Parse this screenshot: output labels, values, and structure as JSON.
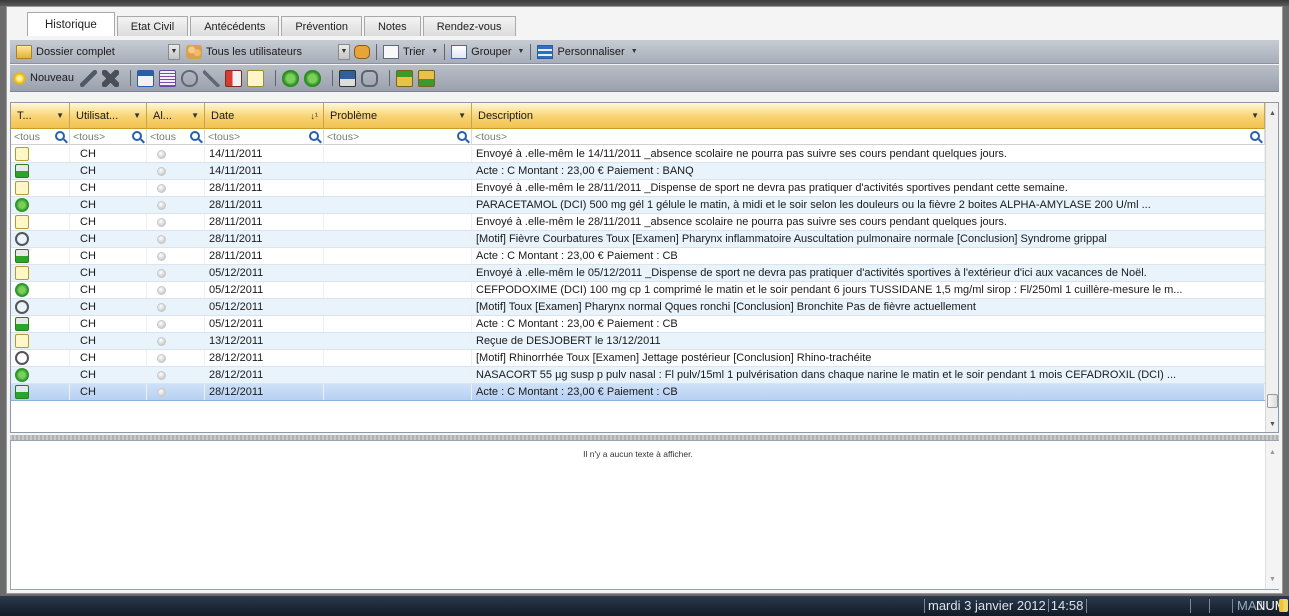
{
  "tabs": [
    {
      "label": "Historique"
    },
    {
      "label": "Etat Civil"
    },
    {
      "label": "Antécédents"
    },
    {
      "label": "Prévention"
    },
    {
      "label": "Notes"
    },
    {
      "label": "Rendez-vous"
    }
  ],
  "toolbar1": {
    "dossier": "Dossier complet",
    "users": "Tous les utilisateurs",
    "trier": "Trier",
    "grouper": "Grouper",
    "personnaliser": "Personnaliser"
  },
  "toolbar2": {
    "nouveau": "Nouveau"
  },
  "grid": {
    "headers": {
      "type": "T...",
      "user": "Utilisat...",
      "al": "Al...",
      "date": "Date",
      "date_sort": "↓¹",
      "prob": "Problème",
      "desc": "Description"
    },
    "filters": {
      "type": "<tous",
      "user": "<tous>",
      "al": "<tous",
      "date": "<tous>",
      "prob": "<tous>",
      "desc": "<tous>"
    },
    "rows": [
      {
        "icon": "absence",
        "user": "CH",
        "date": "14/11/2011",
        "problem": "",
        "description": "Envoyé à  .elle-mêm le 14/11/2011 _absence scolaire    ne pourra pas suivre ses cours pendant quelques jours."
      },
      {
        "icon": "acte",
        "user": "CH",
        "date": "14/11/2011",
        "problem": "",
        "description": "Acte : C  Montant : 23,00 €  Paiement : BANQ"
      },
      {
        "icon": "sport",
        "user": "CH",
        "date": "28/11/2011",
        "problem": "",
        "description": "Envoyé à  .elle-mêm le 28/11/2011 _Dispense de sport      ne devra pas pratiquer d'activités sportives pendant cette semaine."
      },
      {
        "icon": "medic",
        "user": "CH",
        "date": "28/11/2011",
        "problem": "",
        "description": "PARACETAMOL (DCI) 500 mg gél  1 gélule le matin, à midi et le soir selon les douleurs ou la fièvre          2 boites  ALPHA-AMYLASE 200 U/ml ..."
      },
      {
        "icon": "absence",
        "user": "CH",
        "date": "28/11/2011",
        "problem": "",
        "description": "Envoyé à  .elle-mêm le 28/11/2011 _absence scolaire    ne pourra pas suivre ses cours pendant quelques jours."
      },
      {
        "icon": "consult",
        "user": "CH",
        "date": "28/11/2011",
        "problem": "",
        "description": "[Motif] Fièvre  Courbatures  Toux [Examen] Pharynx inflammatoire  Auscultation pulmonaire normale [Conclusion] Syndrome grippal"
      },
      {
        "icon": "acte",
        "user": "CH",
        "date": "28/11/2011",
        "problem": "",
        "description": "Acte : C  Montant : 23,00 €  Paiement : CB"
      },
      {
        "icon": "sport",
        "user": "CH",
        "date": "05/12/2011",
        "problem": "",
        "description": "Envoyé à  .elle-mêm le 05/12/2011 _Dispense de sport      ne devra pas pratiquer d'activités sportives à l'extérieur d'ici aux vacances de Noël."
      },
      {
        "icon": "medic",
        "user": "CH",
        "date": "05/12/2011",
        "problem": "",
        "description": "CEFPODOXIME (DCI) 100 mg cp  1 comprimé le matin et le soir  pendant 6 jours  TUSSIDANE 1,5 mg/ml sirop : Fl/250ml  1 cuillère-mesure le m..."
      },
      {
        "icon": "consult",
        "user": "CH",
        "date": "05/12/2011",
        "problem": "",
        "description": "[Motif] Toux [Examen] Pharynx normal  Qques ronchi [Conclusion] Bronchite   Pas de fièvre actuellement"
      },
      {
        "icon": "acte",
        "user": "CH",
        "date": "05/12/2011",
        "problem": "",
        "description": "Acte : C  Montant : 23,00 €  Paiement : CB"
      },
      {
        "icon": "recu",
        "user": "CH",
        "date": "13/12/2011",
        "problem": "",
        "description": "Reçue de  DESJOBERT le 13/12/2011"
      },
      {
        "icon": "consult",
        "user": "CH",
        "date": "28/12/2011",
        "problem": "",
        "description": "[Motif] Rhinorrhée   Toux [Examen] Jettage postérieur [Conclusion] Rhino-trachéite"
      },
      {
        "icon": "medic",
        "user": "CH",
        "date": "28/12/2011",
        "problem": "",
        "description": "NASACORT 55 µg susp p pulv nasal : Fl pulv/15ml  1 pulvérisation dans chaque narine le matin et le soir  pendant 1 mois  CEFADROXIL (DCI) ..."
      },
      {
        "icon": "acte",
        "user": "CH",
        "date": "28/12/2011",
        "problem": "",
        "description": "Acte : C  Montant : 23,00 €  Paiement : CB",
        "selected": true
      }
    ]
  },
  "preview": {
    "empty_message": "Il n'y a aucun texte à afficher."
  },
  "statusbar": {
    "date": "mardi 3 janvier 2012",
    "time": "14:58",
    "maj": "MAJ",
    "num": "NUM"
  }
}
